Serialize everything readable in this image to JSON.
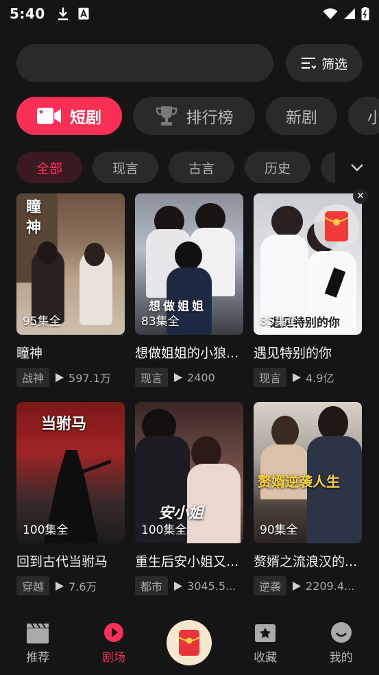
{
  "status_bar": {
    "time": "5:40"
  },
  "search": {
    "placeholder": ""
  },
  "filter": {
    "label": "筛选"
  },
  "categories": [
    {
      "label": "短剧",
      "active": true
    },
    {
      "label": "排行榜",
      "active": false
    },
    {
      "label": "新剧",
      "active": false
    },
    {
      "label": "小",
      "active": false
    }
  ],
  "genres": [
    {
      "label": "全部",
      "active": true
    },
    {
      "label": "现言",
      "active": false
    },
    {
      "label": "古言",
      "active": false
    },
    {
      "label": "历史",
      "active": false
    }
  ],
  "cards": [
    {
      "episodes": "95集全",
      "title": "瞳神",
      "tag": "战神",
      "plays": "597.1万",
      "cover_text": "瞳神"
    },
    {
      "episodes": "83集全",
      "title": "想做姐姐的小狼...",
      "tag": "现言",
      "plays": "2400",
      "cover_text": "想做姐姐"
    },
    {
      "episodes": "85集全",
      "title": "遇见特别的你",
      "tag": "现言",
      "plays": "4.9亿",
      "cover_text": "遇见特别的你"
    },
    {
      "episodes": "100集全",
      "title": "回到古代当驸马",
      "tag": "穿越",
      "plays": "7.6万",
      "cover_text": "当驸马"
    },
    {
      "episodes": "100集全",
      "title": "重生后安小姐又...",
      "tag": "都市",
      "plays": "3045.5...",
      "cover_text": "安小姐"
    },
    {
      "episodes": "90集全",
      "title": "赘婿之流浪汉的...",
      "tag": "逆袭",
      "plays": "2209.4...",
      "cover_text": "赘婿逆袭人生"
    }
  ],
  "nav": {
    "recommend": "推荐",
    "theater": "剧场",
    "favorites": "收藏",
    "mine": "我的"
  },
  "colors": {
    "accent": "#fa2f55",
    "background": "#151515",
    "chip": "#2a2a2a"
  }
}
